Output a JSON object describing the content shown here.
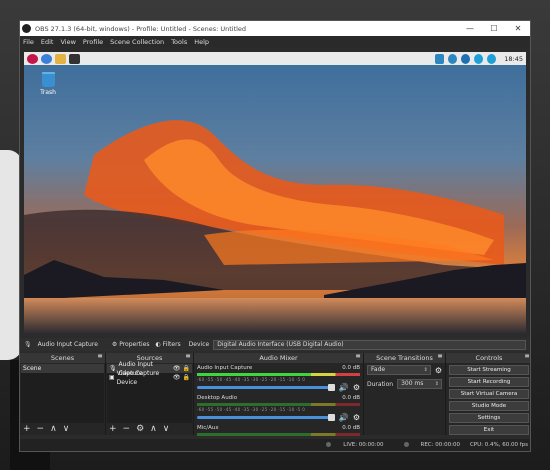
{
  "window": {
    "title": "OBS 27.1.3 (64-bit, windows) - Profile: Untitled - Scenes: Untitled",
    "controls": {
      "minimize": "—",
      "maximize": "☐",
      "close": "✕"
    }
  },
  "menubar": [
    "File",
    "Edit",
    "View",
    "Profile",
    "Scene Collection",
    "Tools",
    "Help"
  ],
  "preview": {
    "taskbar_icons": [
      "raspberry-icon",
      "globe-icon",
      "folder-icon",
      "terminal-icon"
    ],
    "tray_icons": [
      "vnc-icon",
      "download-icon",
      "bluetooth-icon",
      "wifi-icon",
      "volume-icon"
    ],
    "clock": "18:45",
    "desktop_icon_label": "Trash"
  },
  "source_bar": {
    "source_name": "Audio Input Capture",
    "properties": "Properties",
    "filters": "Filters",
    "device_label": "Device",
    "device_value": "Digital Audio Interface (USB Digital Audio)"
  },
  "scenes": {
    "header": "Scenes",
    "items": [
      "Scene"
    ]
  },
  "sources": {
    "header": "Sources",
    "items": [
      "Audio Input Capture",
      "Video Capture Device"
    ]
  },
  "mixer": {
    "header": "Audio Mixer",
    "tracks": [
      {
        "name": "Audio Input Capture",
        "db": "0.0 dB"
      },
      {
        "name": "Desktop Audio",
        "db": "0.0 dB"
      },
      {
        "name": "Mic/Aux",
        "db": "0.0 dB"
      }
    ],
    "ticks": "-60 -55 -50 -45 -40 -35 -30 -25 -20 -15 -10 -5 0"
  },
  "transitions": {
    "header": "Scene Transitions",
    "type": "Fade",
    "duration_label": "Duration",
    "duration_value": "300 ms"
  },
  "controls": {
    "header": "Controls",
    "buttons": [
      "Start Streaming",
      "Start Recording",
      "Start Virtual Camera",
      "Studio Mode",
      "Settings",
      "Exit"
    ]
  },
  "status": {
    "live": "LIVE: 00:00:00",
    "rec": "REC: 00:00:00",
    "cpu": "CPU: 0.4%, 60.00 fps"
  }
}
